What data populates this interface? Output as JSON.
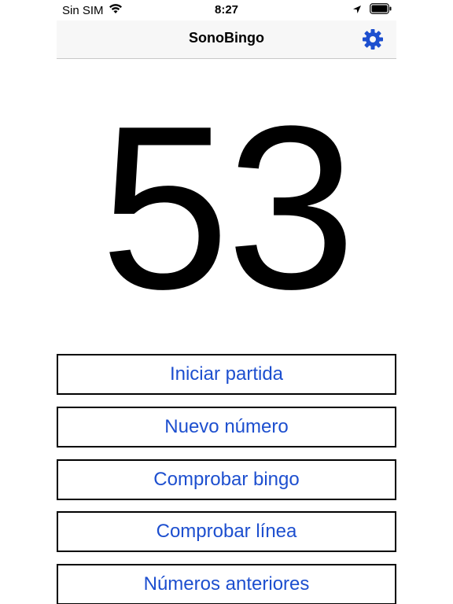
{
  "status_bar": {
    "carrier": "Sin SIM",
    "time": "8:27",
    "icons": [
      "wifi-icon",
      "location-arrow-icon",
      "battery-icon"
    ]
  },
  "nav": {
    "title": "SonoBingo",
    "settings_icon": "gear-icon"
  },
  "current_number": "53",
  "buttons": {
    "start_game": "Iniciar partida",
    "new_number": "Nuevo número",
    "check_bingo": "Comprobar bingo",
    "check_line": "Comprobar línea",
    "previous_numbers": "Números anteriores"
  },
  "colors": {
    "accent": "#1d4fcf",
    "nav_background": "#f7f7f7"
  }
}
